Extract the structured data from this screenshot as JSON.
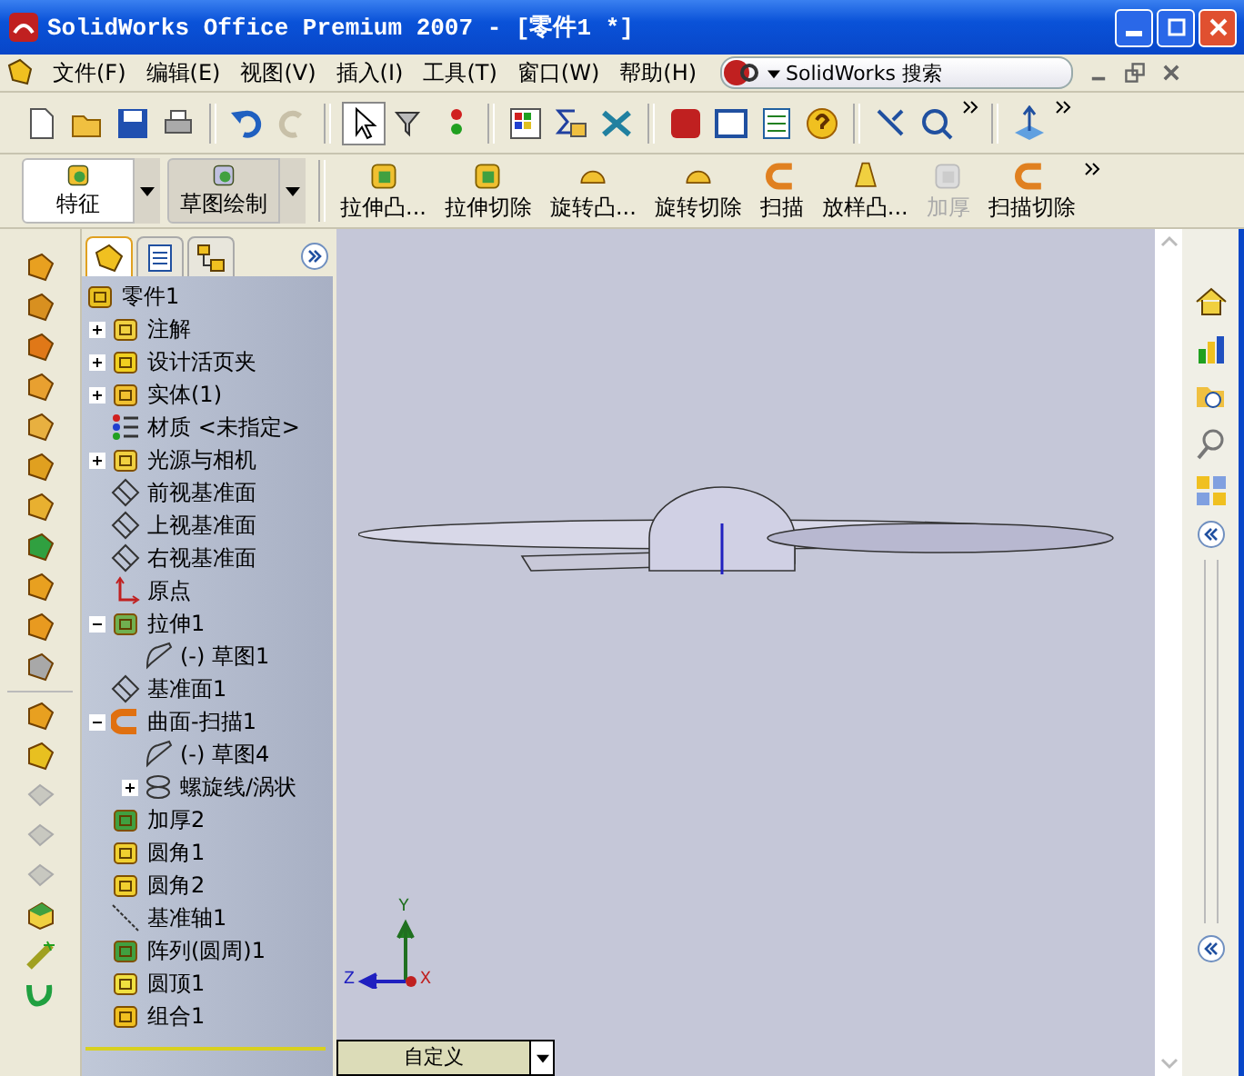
{
  "window": {
    "title": "SolidWorks Office Premium 2007 - [零件1 *]"
  },
  "menu": [
    "文件(F)",
    "编辑(E)",
    "视图(V)",
    "插入(I)",
    "工具(T)",
    "窗口(W)",
    "帮助(H)"
  ],
  "search": {
    "label": "SolidWorks 搜索"
  },
  "command_tabs": [
    {
      "label": "特征",
      "selected": true
    },
    {
      "label": "草图绘制",
      "selected": false
    }
  ],
  "commands": [
    {
      "label": "拉伸凸...",
      "kind": "extrude",
      "disabled": false
    },
    {
      "label": "拉伸切除",
      "kind": "cut",
      "disabled": false
    },
    {
      "label": "旋转凸...",
      "kind": "revolve",
      "disabled": false
    },
    {
      "label": "旋转切除",
      "kind": "revolve-cut",
      "disabled": false
    },
    {
      "label": "扫描",
      "kind": "sweep",
      "disabled": false
    },
    {
      "label": "放样凸...",
      "kind": "loft",
      "disabled": false
    },
    {
      "label": "加厚",
      "kind": "thicken",
      "disabled": true
    },
    {
      "label": "扫描切除",
      "kind": "sweep-cut",
      "disabled": false
    }
  ],
  "panel_tabs": [
    {
      "kind": "feature",
      "selected": true
    },
    {
      "kind": "property",
      "selected": false
    },
    {
      "kind": "config",
      "selected": false
    }
  ],
  "feature_tree": {
    "root": {
      "label": "零件1",
      "kind": "part"
    },
    "items": [
      {
        "label": "注解",
        "kind": "annotation",
        "expanded": false
      },
      {
        "label": "设计活页夹",
        "kind": "binder",
        "expanded": false
      },
      {
        "label": "实体(1)",
        "kind": "body",
        "expanded": false
      },
      {
        "label": "材质 <未指定>",
        "kind": "material"
      },
      {
        "label": "光源与相机",
        "kind": "lights",
        "expanded": false
      },
      {
        "label": "前视基准面",
        "kind": "plane"
      },
      {
        "label": "上视基准面",
        "kind": "plane"
      },
      {
        "label": "右视基准面",
        "kind": "plane"
      },
      {
        "label": "原点",
        "kind": "origin"
      },
      {
        "label": "拉伸1",
        "kind": "extrude",
        "expanded": true,
        "children": [
          {
            "label": "(-) 草图1",
            "kind": "sketch"
          }
        ]
      },
      {
        "label": "基准面1",
        "kind": "plane"
      },
      {
        "label": "曲面-扫描1",
        "kind": "sweep",
        "expanded": true,
        "children": [
          {
            "label": "(-) 草图4",
            "kind": "sketch"
          },
          {
            "label": "螺旋线/涡状",
            "kind": "helix",
            "expanded": false
          }
        ]
      },
      {
        "label": "加厚2",
        "kind": "thicken"
      },
      {
        "label": "圆角1",
        "kind": "fillet"
      },
      {
        "label": "圆角2",
        "kind": "fillet"
      },
      {
        "label": "基准轴1",
        "kind": "axis"
      },
      {
        "label": "阵列(圆周)1",
        "kind": "pattern"
      },
      {
        "label": "圆顶1",
        "kind": "dome"
      },
      {
        "label": "组合1",
        "kind": "combine"
      }
    ]
  },
  "triad": {
    "y": "Y",
    "z": "Z",
    "x": "X"
  },
  "view_dropdown": {
    "value": "自定义"
  }
}
